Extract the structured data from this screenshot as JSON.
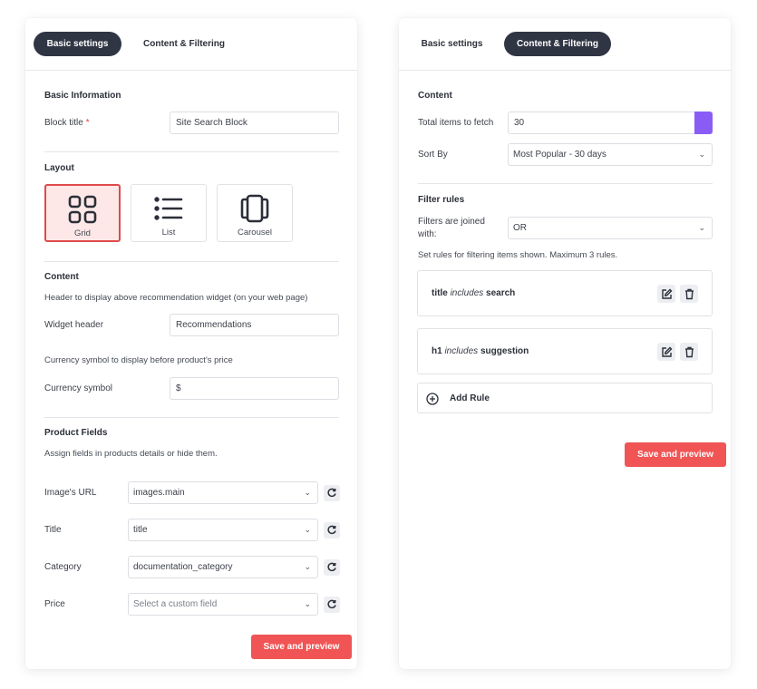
{
  "left": {
    "tabs": [
      {
        "label": "Basic settings",
        "active": true
      },
      {
        "label": "Content & Filtering",
        "active": false
      }
    ],
    "basic_info": {
      "title": "Basic Information",
      "block_title_label": "Block title",
      "required_mark": "*",
      "block_title_value": "Site Search Block"
    },
    "layout": {
      "title": "Layout",
      "options": [
        {
          "label": "Grid",
          "icon": "grid-icon",
          "selected": true
        },
        {
          "label": "List",
          "icon": "list-icon",
          "selected": false
        },
        {
          "label": "Carousel",
          "icon": "carousel-icon",
          "selected": false
        }
      ]
    },
    "content": {
      "title": "Content",
      "header_desc": "Header to display above recommendation widget (on your web page)",
      "widget_header_label": "Widget header",
      "widget_header_value": "Recommendations",
      "currency_desc": "Currency symbol to display before product's price",
      "currency_label": "Currency symbol",
      "currency_value": "$"
    },
    "product_fields": {
      "title": "Product Fields",
      "desc": "Assign fields in products details or hide them.",
      "rows": [
        {
          "label": "Image's URL",
          "value": "images.main",
          "placeholder": false
        },
        {
          "label": "Title",
          "value": "title",
          "placeholder": false
        },
        {
          "label": "Category",
          "value": "documentation_category",
          "placeholder": false
        },
        {
          "label": "Price",
          "value": "Select a custom field",
          "placeholder": true
        }
      ]
    },
    "save_label": "Save and preview"
  },
  "right": {
    "tabs": [
      {
        "label": "Basic settings",
        "active": false
      },
      {
        "label": "Content & Filtering",
        "active": true
      }
    ],
    "content": {
      "title": "Content",
      "total_label": "Total items to fetch",
      "total_value": "30",
      "sort_label": "Sort By",
      "sort_value": "Most Popular - 30 days"
    },
    "filter": {
      "title": "Filter rules",
      "joined_label": "Filters are joined with:",
      "joined_value": "OR",
      "desc": "Set rules for filtering items shown. Maximum 3 rules.",
      "rules": [
        {
          "field": "title",
          "op": "includes",
          "value": "search"
        },
        {
          "field": "h1",
          "op": "includes",
          "value": "suggestion"
        }
      ],
      "add_rule_label": "Add Rule"
    },
    "save_label": "Save and preview"
  },
  "colors": {
    "accent": "#f05454",
    "dark_tab": "#2f3543",
    "selected_bg": "#fde7e7",
    "purple": "#8a5cf6"
  }
}
